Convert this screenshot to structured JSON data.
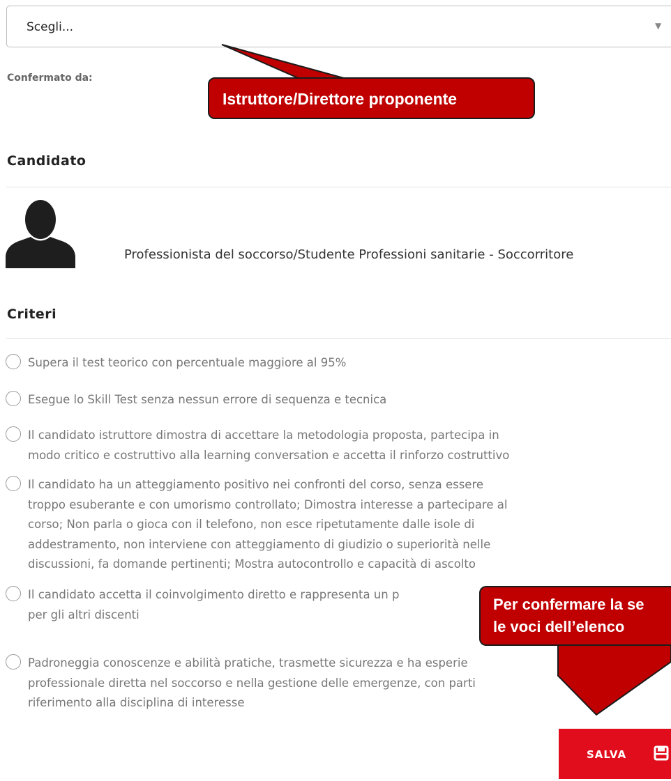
{
  "select": {
    "value": "Scegli...",
    "arrow_icon": "triangle-down"
  },
  "confirmed_by_label": "Confermato da:",
  "candidate": {
    "section_title": "Candidato",
    "avatar_icon": "person-silhouette",
    "role_text": "Professionista del soccorso/Studente Professioni sanitarie - Soccorritore"
  },
  "criteria": {
    "section_title": "Criteri",
    "items": [
      {
        "lines": [
          "Supera il test teorico con percentuale maggiore al 95%"
        ]
      },
      {
        "lines": [
          "Esegue lo Skill Test senza nessun errore di sequenza e tecnica"
        ]
      },
      {
        "lines": [
          "Il candidato istruttore dimostra di accettare la metodologia proposta, partecipa in",
          "modo critico e costruttivo alla learning conversation e accetta il rinforzo costruttivo"
        ]
      },
      {
        "lines": [
          "Il candidato ha un atteggiamento positivo nei confronti del corso, senza essere",
          "troppo esuberante e con umorismo controllato; Dimostra interesse a partecipare al",
          "corso; Non parla o gioca con il telefono, non esce ripetutamente dalle isole di",
          "addestramento, non interviene con atteggiamento di giudizio o superiorità nelle",
          "discussioni, fa domande pertinenti; Mostra autocontrollo e capacità di ascolto"
        ]
      },
      {
        "lines": [
          "Il candidato accetta il coinvolgimento diretto e rappresenta un p",
          "per gli altri discenti"
        ]
      },
      {
        "lines": [
          "Padroneggia conoscenze e abilità pratiche, trasmette sicurezza e ha esperie",
          "professionale diretta nel soccorso e nella gestione delle emergenze, con parti",
          "riferimento alla disciplina di interesse"
        ]
      }
    ]
  },
  "save_button": {
    "label": "SALVA",
    "icon": "save-icon"
  },
  "callouts": {
    "top": "Istruttore/Direttore proponente",
    "bottom_line1": "Per confermare la se",
    "bottom_line2": "le voci dell’elenco"
  },
  "colors": {
    "accent_red": "#e10d1c",
    "callout_red": "#c00000"
  }
}
